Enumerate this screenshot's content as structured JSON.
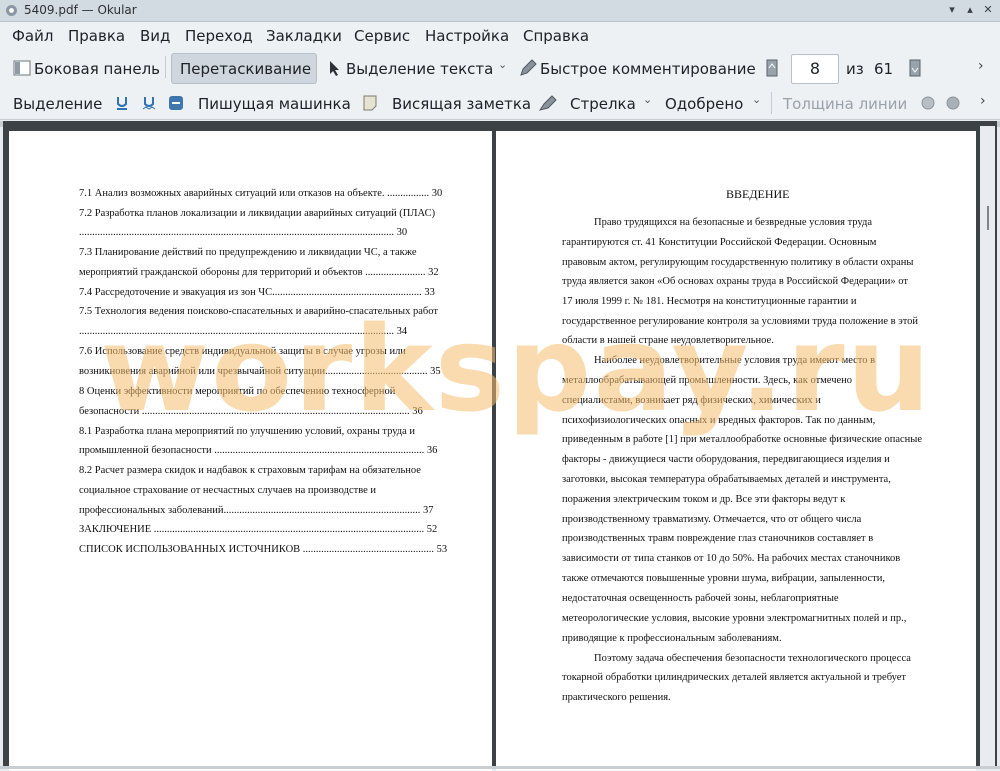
{
  "window": {
    "title": "5409.pdf  — Okular"
  },
  "menu": [
    "Файл",
    "Правка",
    "Вид",
    "Переход",
    "Закладки",
    "Сервис",
    "Настройка",
    "Справка"
  ],
  "toolbar1": {
    "sidebar": "Боковая панель",
    "drag": "Перетаскивание",
    "text_select": "Выделение текста",
    "quick_annot": "Быстрое комментирование",
    "page_current": "8",
    "page_of": "из",
    "page_total": "61"
  },
  "toolbar2": {
    "highlight": "Выделение",
    "typewriter": "Пишущая машинка",
    "note": "Висящая заметка",
    "arrow": "Стрелка",
    "approved": "Одобрено",
    "line_width": "Толщина линии"
  },
  "toc": [
    "7.1 Анализ возможных аварийных ситуаций или отказов на объекте. ................ 30",
    "7.2 Разработка планов локализации и ликвидации аварийных ситуаций (ПЛАС)",
    "........................................................................................................................ 30",
    "7.3 Планирование действий по предупреждению и ликвидации ЧС, а также",
    "мероприятий гражданской обороны для территорий и объектов ....................... 32",
    "7.4 Рассредоточение и эвакуация из зон ЧС......................................................... 33",
    "7.5 Технология ведения поисково-спасательных и аварийно-спасательных работ",
    "........................................................................................................................ 34",
    "7.6 Использование средств индивидуальной защиты в случае угрозы или",
    "возникновения аварийной или чрезвычайной ситуации....................................... 35",
    "8 Оценки эффективности мероприятий по обеспечению техносферной",
    "безопасности ...................................................................................................... 36",
    "8.1 Разработка плана мероприятий по улучшению условий, охраны труда и",
    "промышленной безопасности ................................................................................ 36",
    "8.2 Расчет размера скидок и надбавок к страховым тарифам на обязательное",
    "социальное страхование от несчастных случаев на производстве и",
    "профессиональных заболеваний........................................................................... 37",
    "ЗАКЛЮЧЕНИЕ ....................................................................................................... 52",
    "СПИСОК ИСПОЛЬЗОВАННЫХ ИСТОЧНИКОВ .................................................. 53"
  ],
  "intro": {
    "title": "ВВЕДЕНИЕ",
    "lines": [
      "Право трудящихся на безопасные и безвредные условия труда",
      "гарантируются ст. 41 Конституции Российской Федерации. Основным",
      "правовым актом, регулирующим государственную политику в области охраны",
      "труда является закон «Об основах охраны труда в Российской Федерации» от",
      "17 июля 1999 г. № 181. Несмотря на конституционные гарантии и",
      "государственное регулирование контроля за условиями труда положение в этой",
      "области в нашей стране неудовлетворительное.",
      "Наиболее неудовлетворительные условия труда имеют место в",
      "металлообрабатывающей промышленности. Здесь, как отмечено",
      "специалистами, возникает ряд физических, химических и",
      "психофизиологических опасных и вредных факторов. Так по данным,",
      "приведенным в работе [1] при металлообработке основные физические опасные",
      "факторы - движущиеся части оборудования, передвигающиеся изделия и",
      "заготовки, высокая температура обрабатываемых деталей и инструмента,",
      "поражения электрическим током и др. Все эти факторы ведут к",
      "производственному травматизму. Отмечается, что от общего числа",
      "производственных травм повреждение глаз станочников составляет в",
      "зависимости от типа станков от 10 до 50%. На рабочих местах станочников",
      "также отмечаются повышенные уровни шума, вибрации, запыленности,",
      "недостаточная освещенность рабочей зоны, неблагоприятные",
      "метеорологические условия, высокие уровни электромагнитных полей и пр.,",
      "приводящие к профессиональным заболеваниям.",
      "Поэтому задача обеспечения безопасности технологического процесса",
      "токарной обработки цилиндрических деталей является актуальной и требует",
      "практического решения."
    ]
  },
  "watermark": "workspay.ru"
}
